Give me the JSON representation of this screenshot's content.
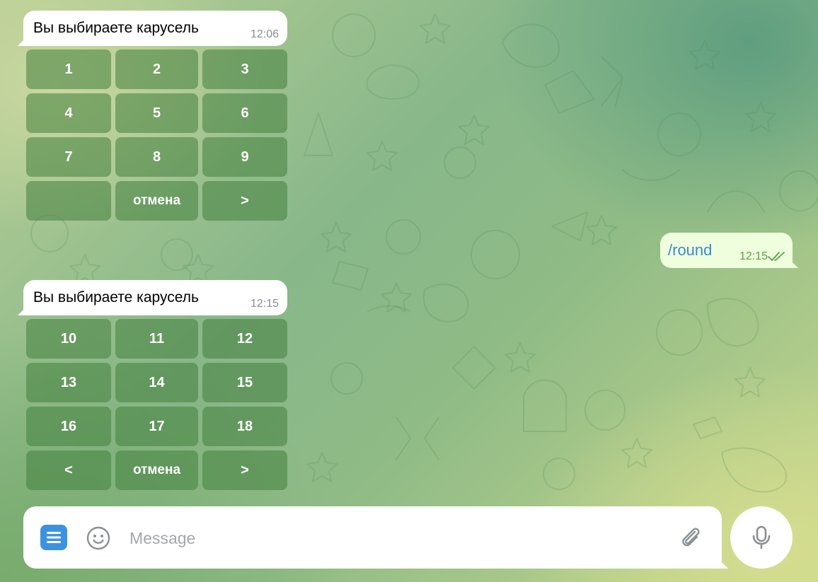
{
  "colors": {
    "keyboard_button": "#44803e",
    "outgoing_bubble": "#effedd",
    "outgoing_text": "#3a8ad1",
    "outgoing_time": "#57a14b",
    "menu_button": "#3d92e0"
  },
  "messages": [
    {
      "text": "Вы выбираете карусель",
      "time": "12:06",
      "keyboard": [
        "1",
        "2",
        "3",
        "4",
        "5",
        "6",
        "7",
        "8",
        "9",
        "",
        "отмена",
        ">"
      ]
    },
    {
      "text": "/round",
      "time": "12:15",
      "status_icon": "double-check-icon"
    },
    {
      "text": "Вы выбираете карусель",
      "time": "12:15",
      "keyboard": [
        "10",
        "11",
        "12",
        "13",
        "14",
        "15",
        "16",
        "17",
        "18",
        "<",
        "отмена",
        ">"
      ]
    }
  ],
  "composer": {
    "placeholder": "Message",
    "menu_icon": "menu-icon",
    "emoji_icon": "smile-icon",
    "attach_icon": "paperclip-icon",
    "mic_icon": "microphone-icon"
  }
}
